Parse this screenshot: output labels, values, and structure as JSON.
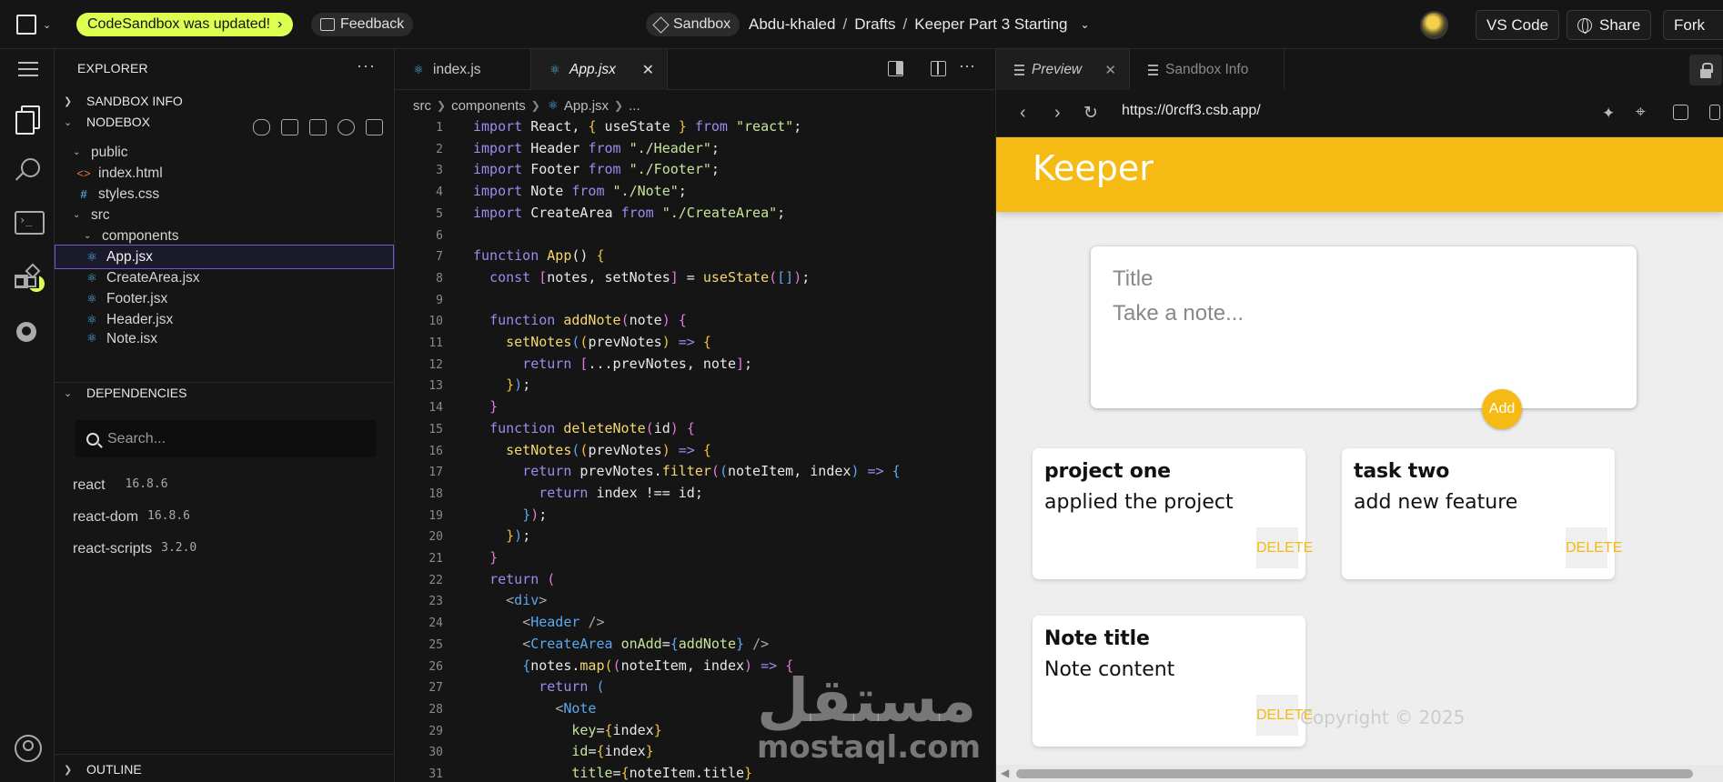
{
  "topbar": {
    "update_label": "CodeSandbox was updated!",
    "feedback_label": "Feedback",
    "sandbox_label": "Sandbox",
    "crumbs": [
      "Abdu-khaled",
      "Drafts",
      "Keeper Part 3 Starting"
    ],
    "vscode_label": "VS Code",
    "share_label": "Share",
    "fork_label": "Fork"
  },
  "activity": {
    "terminal_badge": "1"
  },
  "explorer": {
    "title": "EXPLORER",
    "sandbox_info": "SANDBOX INFO",
    "nodebox": "NODEBOX",
    "tree": [
      {
        "label": "public",
        "type": "folder"
      },
      {
        "label": "index.html",
        "type": "html"
      },
      {
        "label": "styles.css",
        "type": "css"
      },
      {
        "label": "src",
        "type": "folder"
      },
      {
        "label": "components",
        "type": "folder"
      },
      {
        "label": "App.jsx",
        "type": "react",
        "selected": true
      },
      {
        "label": "CreateArea.jsx",
        "type": "react"
      },
      {
        "label": "Footer.jsx",
        "type": "react"
      },
      {
        "label": "Header.jsx",
        "type": "react"
      },
      {
        "label": "Note.jsx",
        "type": "react"
      }
    ],
    "dependencies_label": "DEPENDENCIES",
    "search_placeholder": "Search...",
    "dependencies": [
      {
        "name": "react",
        "version": "16.8.6"
      },
      {
        "name": "react-dom",
        "version": "16.8.6"
      },
      {
        "name": "react-scripts",
        "version": "3.2.0"
      }
    ],
    "outline_label": "OUTLINE"
  },
  "editor": {
    "tabs": [
      {
        "label": "index.js"
      },
      {
        "label": "App.jsx",
        "active": true
      }
    ],
    "breadcrumb": [
      "src",
      "components",
      "App.jsx",
      "..."
    ],
    "line_numbers": [
      "1",
      "2",
      "3",
      "4",
      "5",
      "6",
      "7",
      "8",
      "9",
      "10",
      "11",
      "12",
      "13",
      "14",
      "15",
      "16",
      "17",
      "18",
      "19",
      "20",
      "21",
      "22",
      "23",
      "24",
      "25",
      "26",
      "27",
      "28",
      "29",
      "30",
      "31"
    ]
  },
  "watermark": {
    "arabic": "مستقل",
    "latin": "mostaql.com"
  },
  "preview": {
    "tabs": [
      {
        "label": "Preview",
        "active": true
      },
      {
        "label": "Sandbox Info"
      }
    ],
    "url": "https://0rcff3.csb.app/",
    "app": {
      "title": "Keeper",
      "title_placeholder": "Title",
      "content_placeholder": "Take a note...",
      "add_label": "Add",
      "notes": [
        {
          "title": "project one",
          "content": "applied the project",
          "delete_label": "DELETE"
        },
        {
          "title": "task two",
          "content": "add new feature",
          "delete_label": "DELETE"
        },
        {
          "title": "Note title",
          "content": "Note content",
          "delete_label": "DELETE"
        }
      ],
      "footer": "Copyright © 2025"
    }
  },
  "colors": {
    "accent_lime": "#dcff50",
    "keeper_yellow": "#f5ba13",
    "selection_border": "#6b5bd4"
  }
}
